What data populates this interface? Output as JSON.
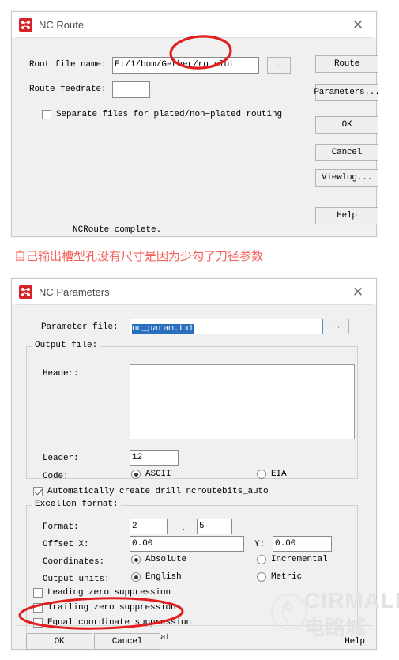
{
  "page": {
    "background": "#ffffff",
    "annotation_color": "#e02020",
    "caption_color": "#f4605a"
  },
  "nc_route_dialog": {
    "icon": "nc-app-icon",
    "title": "NC Route",
    "close_label": "✕",
    "fields": {
      "root_file_label": "Root file name:",
      "root_file_value": "E:/1/bom/Gerber/ro slot",
      "browse_label": "...",
      "feedrate_label": "Route feedrate:",
      "feedrate_value": ""
    },
    "checkbox": {
      "label": "Separate files for plated/non−plated routing",
      "checked": false
    },
    "buttons": [
      "Route",
      "Parameters...",
      "OK",
      "Cancel",
      "Viewlog...",
      "Help"
    ],
    "status": "NCRoute complete."
  },
  "caption": {
    "text": "自己输出槽型孔没有尺寸是因为少勾了刀径参数"
  },
  "nc_parameters_dialog": {
    "icon": "nc-app-icon",
    "title": "NC Parameters",
    "close_label": "✕",
    "parameter_file": {
      "label": "Parameter file:",
      "value": "nc_param.txt",
      "selected": true,
      "browse_label": "..."
    },
    "output_file_group": {
      "title": "Output file:",
      "header_label": "Header:",
      "header_value": "",
      "leader_label": "Leader:",
      "leader_value": "12",
      "code_label": "Code:",
      "code_options": [
        {
          "label": "ASCII",
          "selected": true
        },
        {
          "label": "EIA",
          "selected": false
        }
      ],
      "auto_create_checkbox": {
        "label": "Automatically create drill ncroutebits_auto",
        "checked": true
      }
    },
    "excellon_group": {
      "title": "Excellon format:",
      "format_label": "Format:",
      "format_int": "2",
      "format_dot": ".",
      "format_dec": "5",
      "offset_x_label": "Offset X:",
      "offset_x_value": "0.00",
      "offset_y_label": "Y:",
      "offset_y_value": "0.00",
      "coordinates_label": "Coordinates:",
      "coordinate_options": [
        {
          "label": "Absolute",
          "selected": true
        },
        {
          "label": "Incremental",
          "selected": false
        }
      ],
      "units_label": "Output units:",
      "unit_options": [
        {
          "label": "English",
          "selected": true
        },
        {
          "label": "Metric",
          "selected": false
        }
      ],
      "suppression_checkboxes": [
        {
          "label": "Leading zero suppression",
          "checked": false
        },
        {
          "label": "Trailing zero suppression",
          "checked": false
        },
        {
          "label": "Equal coordinate suppression",
          "checked": false
        },
        {
          "label": "Enhanced Excellon format",
          "checked": true
        }
      ]
    },
    "buttons": [
      "OK",
      "Cancel",
      "Help"
    ]
  },
  "watermark": {
    "brand": "CIRMALL",
    "brand_cn": "电路城"
  }
}
